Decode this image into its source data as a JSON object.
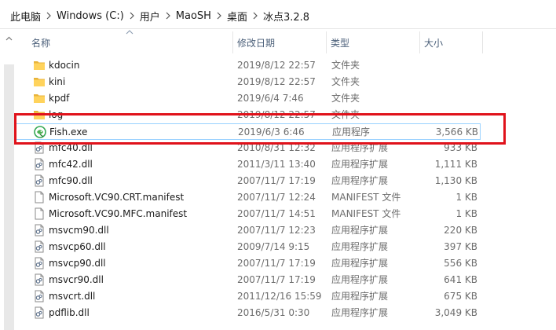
{
  "breadcrumb": {
    "items": [
      "此电脑",
      "Windows (C:)",
      "用户",
      "MaoSH",
      "桌面",
      "冰点3.2.8"
    ]
  },
  "columns": {
    "name": "名称",
    "date": "修改日期",
    "type": "类型",
    "size": "大小"
  },
  "files": [
    {
      "name": "kdocin",
      "date": "2019/8/12 22:57",
      "type": "文件夹",
      "size": "",
      "icon": "folder-icon"
    },
    {
      "name": "kini",
      "date": "2019/8/12 22:57",
      "type": "文件夹",
      "size": "",
      "icon": "folder-icon"
    },
    {
      "name": "kpdf",
      "date": "2019/6/4 7:46",
      "type": "文件夹",
      "size": "",
      "icon": "folder-icon"
    },
    {
      "name": "log",
      "date": "2019/8/12 22:57",
      "type": "文件夹",
      "size": "",
      "icon": "folder-icon"
    },
    {
      "name": "Fish.exe",
      "date": "2019/6/3 6:46",
      "type": "应用程序",
      "size": "3,566 KB",
      "icon": "fish-app-icon"
    },
    {
      "name": "mfc40.dll",
      "date": "2010/8/31 12:32",
      "type": "应用程序扩展",
      "size": "933 KB",
      "icon": "dll-icon"
    },
    {
      "name": "mfc42.dll",
      "date": "2011/3/11 13:40",
      "type": "应用程序扩展",
      "size": "1,111 KB",
      "icon": "dll-icon"
    },
    {
      "name": "mfc90.dll",
      "date": "2007/11/7 17:19",
      "type": "应用程序扩展",
      "size": "1,130 KB",
      "icon": "dll-icon"
    },
    {
      "name": "Microsoft.VC90.CRT.manifest",
      "date": "2007/11/7 12:24",
      "type": "MANIFEST 文件",
      "size": "1 KB",
      "icon": "file-icon"
    },
    {
      "name": "Microsoft.VC90.MFC.manifest",
      "date": "2007/11/7 14:51",
      "type": "MANIFEST 文件",
      "size": "1 KB",
      "icon": "file-icon"
    },
    {
      "name": "msvcm90.dll",
      "date": "2007/11/7 12:23",
      "type": "应用程序扩展",
      "size": "220 KB",
      "icon": "dll-icon"
    },
    {
      "name": "msvcp60.dll",
      "date": "2009/7/14 9:15",
      "type": "应用程序扩展",
      "size": "397 KB",
      "icon": "dll-icon"
    },
    {
      "name": "msvcp90.dll",
      "date": "2007/11/7 17:19",
      "type": "应用程序扩展",
      "size": "556 KB",
      "icon": "dll-icon"
    },
    {
      "name": "msvcr90.dll",
      "date": "2007/11/7 17:19",
      "type": "应用程序扩展",
      "size": "641 KB",
      "icon": "dll-icon"
    },
    {
      "name": "msvcrt.dll",
      "date": "2011/12/16 15:59",
      "type": "应用程序扩展",
      "size": "675 KB",
      "icon": "dll-icon"
    },
    {
      "name": "pdflib.dll",
      "date": "2016/5/31 0:30",
      "type": "应用程序扩展",
      "size": "3,049 KB",
      "icon": "dll-icon"
    }
  ],
  "selected_index": 4,
  "colors": {
    "selection_border": "#99d1ff",
    "annotation_red": "#e0121b",
    "folder_yellow": "#ffd35c"
  }
}
